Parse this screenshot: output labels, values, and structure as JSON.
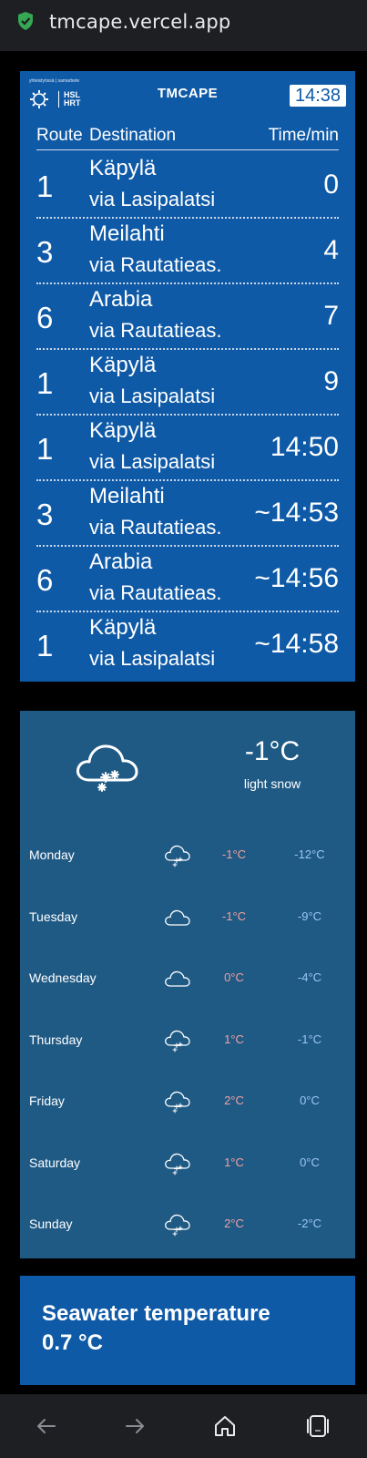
{
  "browser": {
    "url": "tmcape.vercel.app"
  },
  "header": {
    "logo_text": "yhteistyössä | samarbete",
    "hsl_line1": "HSL",
    "hsl_line2": "HRT",
    "brand": "TMCAPE",
    "clock": "14:38"
  },
  "columns": {
    "route": "Route",
    "destination": "Destination",
    "time": "Time/min"
  },
  "departures": [
    {
      "route": "1",
      "dest": "Käpylä",
      "via": "via Lasipalatsi",
      "time": "0"
    },
    {
      "route": "3",
      "dest": "Meilahti",
      "via": "via Rautatieas.",
      "time": "4"
    },
    {
      "route": "6",
      "dest": "Arabia",
      "via": "via Rautatieas.",
      "time": "7"
    },
    {
      "route": "1",
      "dest": "Käpylä",
      "via": "via Lasipalatsi",
      "time": "9"
    },
    {
      "route": "1",
      "dest": "Käpylä",
      "via": "via Lasipalatsi",
      "time": "14:50"
    },
    {
      "route": "3",
      "dest": "Meilahti",
      "via": "via Rautatieas.",
      "time": "~14:53"
    },
    {
      "route": "6",
      "dest": "Arabia",
      "via": "via Rautatieas.",
      "time": "~14:56"
    },
    {
      "route": "1",
      "dest": "Käpylä",
      "via": "via Lasipalatsi",
      "time": "~14:58"
    }
  ],
  "weather": {
    "current_temp": "-1°C",
    "current_desc": "light snow",
    "current_icon": "snow-cloud-icon",
    "days": [
      {
        "name": "Monday",
        "icon": "snow-cloud-icon",
        "hi": "-1°C",
        "lo": "-12°C"
      },
      {
        "name": "Tuesday",
        "icon": "cloud-icon",
        "hi": "-1°C",
        "lo": "-9°C"
      },
      {
        "name": "Wednesday",
        "icon": "cloud-icon",
        "hi": "0°C",
        "lo": "-4°C"
      },
      {
        "name": "Thursday",
        "icon": "snow-cloud-icon",
        "hi": "1°C",
        "lo": "-1°C"
      },
      {
        "name": "Friday",
        "icon": "snow-cloud-icon",
        "hi": "2°C",
        "lo": "0°C"
      },
      {
        "name": "Saturday",
        "icon": "snow-cloud-icon",
        "hi": "1°C",
        "lo": "0°C"
      },
      {
        "name": "Sunday",
        "icon": "snow-cloud-icon",
        "hi": "2°C",
        "lo": "-2°C"
      }
    ]
  },
  "sea": {
    "label": "Seawater temperature",
    "value": "0.7 °C"
  },
  "colors": {
    "board_blue": "#0f5aa7",
    "weather_blue": "#1f5a85",
    "secure_green": "#34a853"
  }
}
